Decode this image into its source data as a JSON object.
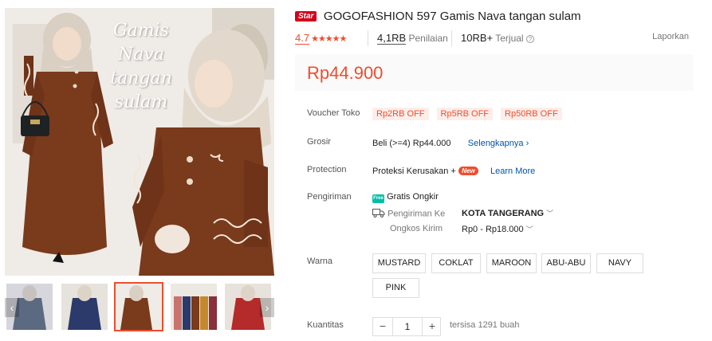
{
  "gallery": {
    "overlay_line1": "Gamis Nava",
    "overlay_line2": "tangan sulam",
    "nav_prev_icon": "chevron-left-icon",
    "nav_next_icon": "chevron-right-icon",
    "thumb_colors": [
      "#5b6a80",
      "#2b3a6b",
      "#8b4a2a",
      "#c9736d",
      "#b52a2a"
    ]
  },
  "product": {
    "badge": "Star",
    "title": "GOGOFASHION 597 Gamis Nava tangan sulam",
    "rating": "4.7",
    "rating_stars": "★★★★★",
    "reviews_count": "4,1RB",
    "reviews_label": "Penilaian",
    "sold_count": "10RB+",
    "sold_label": "Terjual",
    "report": "Laporkan",
    "price": "Rp44.900"
  },
  "voucher": {
    "label": "Voucher Toko",
    "items": [
      "Rp2RB OFF",
      "Rp5RB OFF",
      "Rp50RB OFF"
    ]
  },
  "grosir": {
    "label": "Grosir",
    "text": "Beli (>=4) Rp44.000",
    "link": "Selengkapnya"
  },
  "protection": {
    "label": "Protection",
    "text": "Proteksi Kerusakan +",
    "badge": "New",
    "link": "Learn More"
  },
  "shipping": {
    "label": "Pengiriman",
    "free_icon_text": "Free",
    "free_text": "Gratis Ongkir",
    "to_label": "Pengiriman Ke",
    "to_value": "KOTA TANGERANG",
    "cost_label": "Ongkos Kirim",
    "cost_value": "Rp0 - Rp18.000"
  },
  "variants": {
    "label": "Warna",
    "options": [
      "MUSTARD",
      "COKLAT",
      "MAROON",
      "ABU-ABU",
      "NAVY",
      "PINK"
    ]
  },
  "quantity": {
    "label": "Kuantitas",
    "minus": "−",
    "value": "1",
    "plus": "+",
    "stock": "tersisa 1291 buah"
  },
  "colors": {
    "accent": "#ee4d2d",
    "link": "#0055aa",
    "dress": "#7a3a1c"
  }
}
